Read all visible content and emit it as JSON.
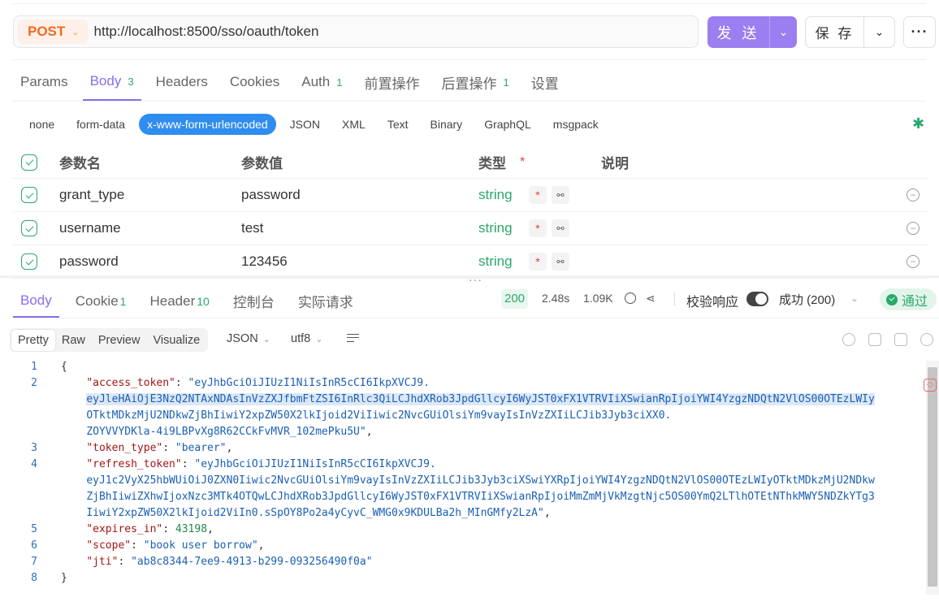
{
  "request": {
    "method": "POST",
    "url": "http://localhost:8500/sso/oauth/token",
    "send_label": "发 送",
    "save_label": "保 存"
  },
  "request_tabs": [
    {
      "label": "Params",
      "count": ""
    },
    {
      "label": "Body",
      "count": "3"
    },
    {
      "label": "Headers",
      "count": ""
    },
    {
      "label": "Cookies",
      "count": ""
    },
    {
      "label": "Auth",
      "count": "1"
    },
    {
      "label": "前置操作",
      "count": ""
    },
    {
      "label": "后置操作",
      "count": "1"
    },
    {
      "label": "设置",
      "count": ""
    }
  ],
  "body_types": [
    "none",
    "form-data",
    "x-www-form-urlencoded",
    "JSON",
    "XML",
    "Text",
    "Binary",
    "GraphQL",
    "msgpack"
  ],
  "params_header": {
    "name": "参数名",
    "value": "参数值",
    "type": "类型",
    "required_mark": "*",
    "desc": "说明"
  },
  "params": [
    {
      "name": "grant_type",
      "value": "password",
      "type": "string"
    },
    {
      "name": "username",
      "value": "test",
      "type": "string"
    },
    {
      "name": "password",
      "value": "123456",
      "type": "string"
    }
  ],
  "response_tabs": [
    {
      "label": "Body",
      "count": ""
    },
    {
      "label": "Cookie",
      "count": "1"
    },
    {
      "label": "Header",
      "count": "10"
    },
    {
      "label": "控制台",
      "count": ""
    },
    {
      "label": "实际请求",
      "count": ""
    }
  ],
  "response_meta": {
    "status_code": "200",
    "time": "2.48s",
    "size": "1.09K",
    "verify_label": "校验响应",
    "verify_on": true,
    "result_status": "成功 (200)",
    "pass_label": "通过"
  },
  "view_modes": [
    "Pretty",
    "Raw",
    "Preview",
    "Visualize"
  ],
  "format": "JSON",
  "encoding": "utf8",
  "code_lines": [
    {
      "n": "1",
      "parts": [
        {
          "t": "{",
          "c": ""
        }
      ]
    },
    {
      "n": "2",
      "parts": [
        {
          "t": "    ",
          "c": ""
        },
        {
          "t": "\"access_token\"",
          "c": "k"
        },
        {
          "t": ": ",
          "c": ""
        },
        {
          "t": "\"eyJhbGciOiJIUzI1NiIsInR5cCI6IkpXVCJ9.",
          "c": "s"
        }
      ]
    },
    {
      "n": "",
      "parts": [
        {
          "t": "    ",
          "c": ""
        },
        {
          "t": "eyJleHAiOjE3NzQ2NTAxNDAsInVzZXJfbmFtZSI6InRlc3QiLCJhdXRob3JpdGllcyI6WyJST0xFX1VTRVIiXSwianRpIjoiYWI4YzgzNDQtN2VlOS00OTEzLWIy",
          "c": "s hl"
        }
      ]
    },
    {
      "n": "",
      "parts": [
        {
          "t": "    ",
          "c": ""
        },
        {
          "t": "OTktMDkzMjU2NDkwZjBhIiwiY2xpZW50X2lkIjoid2ViIiwic2NvcGUiOlsiYm9vayIsInVzZXIiLCJib3Jyb3ciXX0.",
          "c": "s"
        }
      ]
    },
    {
      "n": "",
      "parts": [
        {
          "t": "    ",
          "c": ""
        },
        {
          "t": "ZOYVVYDKla-4i9LBPvXg8R62CCkFvMVR_102mePku5U\"",
          "c": "s"
        },
        {
          "t": ",",
          "c": ""
        }
      ]
    },
    {
      "n": "3",
      "parts": [
        {
          "t": "    ",
          "c": ""
        },
        {
          "t": "\"token_type\"",
          "c": "k"
        },
        {
          "t": ": ",
          "c": ""
        },
        {
          "t": "\"bearer\"",
          "c": "s"
        },
        {
          "t": ",",
          "c": ""
        }
      ]
    },
    {
      "n": "4",
      "parts": [
        {
          "t": "    ",
          "c": ""
        },
        {
          "t": "\"refresh_token\"",
          "c": "k"
        },
        {
          "t": ": ",
          "c": ""
        },
        {
          "t": "\"eyJhbGciOiJIUzI1NiIsInR5cCI6IkpXVCJ9.",
          "c": "s"
        }
      ]
    },
    {
      "n": "",
      "parts": [
        {
          "t": "    ",
          "c": ""
        },
        {
          "t": "eyJ1c2VyX25hbWUiOiJ0ZXN0Iiwic2NvcGUiOlsiYm9vayIsInVzZXIiLCJib3Jyb3ciXSwiYXRpIjoiYWI4YzgzNDQtN2VlOS00OTEzLWIyOTktMDkzMjU2NDkw",
          "c": "s"
        }
      ]
    },
    {
      "n": "",
      "parts": [
        {
          "t": "    ",
          "c": ""
        },
        {
          "t": "ZjBhIiwiZXhwIjoxNzc3MTk4OTQwLCJhdXRob3JpdGllcyI6WyJST0xFX1VTRVIiXSwianRpIjoiMmZmMjVkMzgtNjc5OS00YmQ2LTlhOTEtNThkMWY5NDZkYTg3",
          "c": "s"
        }
      ]
    },
    {
      "n": "",
      "parts": [
        {
          "t": "    ",
          "c": ""
        },
        {
          "t": "IiwiY2xpZW50X2lkIjoid2ViIn0.sSpOY8Po2a4yCyvC_WMG0x9KDULBa2h_MInGMfy2LzA\"",
          "c": "s"
        },
        {
          "t": ",",
          "c": ""
        }
      ]
    },
    {
      "n": "5",
      "parts": [
        {
          "t": "    ",
          "c": ""
        },
        {
          "t": "\"expires_in\"",
          "c": "k"
        },
        {
          "t": ": ",
          "c": ""
        },
        {
          "t": "43198",
          "c": "n"
        },
        {
          "t": ",",
          "c": ""
        }
      ]
    },
    {
      "n": "6",
      "parts": [
        {
          "t": "    ",
          "c": ""
        },
        {
          "t": "\"scope\"",
          "c": "k"
        },
        {
          "t": ": ",
          "c": ""
        },
        {
          "t": "\"book user borrow\"",
          "c": "s"
        },
        {
          "t": ",",
          "c": ""
        }
      ]
    },
    {
      "n": "7",
      "parts": [
        {
          "t": "    ",
          "c": ""
        },
        {
          "t": "\"jti\"",
          "c": "k"
        },
        {
          "t": ": ",
          "c": ""
        },
        {
          "t": "\"ab8c8344-7ee9-4913-b299-093256490f0a\"",
          "c": "s"
        }
      ]
    },
    {
      "n": "8",
      "parts": [
        {
          "t": "}",
          "c": ""
        }
      ]
    }
  ],
  "colors": {
    "accent": "#8a6ef0",
    "send_bg": "#9b7ef0",
    "method": "#f06b20",
    "success": "#2aa86a",
    "chip_active": "#2f8df0"
  }
}
